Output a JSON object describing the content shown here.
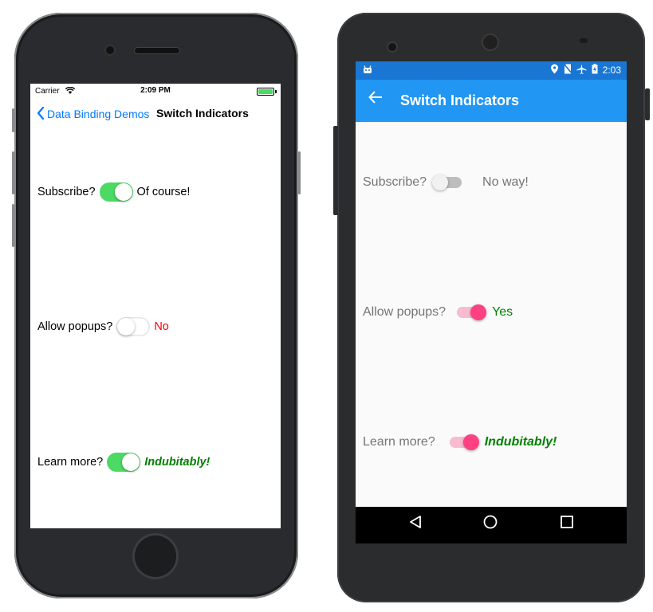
{
  "ios": {
    "status": {
      "carrier": "Carrier",
      "time": "2:09 PM"
    },
    "nav": {
      "back_label": "Data Binding Demos",
      "title": "Switch Indicators"
    },
    "rows": [
      {
        "label": "Subscribe?",
        "on": true,
        "answer": "Of course!"
      },
      {
        "label": "Allow popups?",
        "on": false,
        "answer": "No"
      },
      {
        "label": "Learn more?",
        "on": true,
        "answer": "Indubitably!"
      }
    ]
  },
  "android": {
    "status": {
      "time": "2:03"
    },
    "appbar": {
      "title": "Switch Indicators"
    },
    "rows": [
      {
        "label": "Subscribe?",
        "on": false,
        "answer": "No way!"
      },
      {
        "label": "Allow popups?",
        "on": true,
        "answer": "Yes"
      },
      {
        "label": "Learn more?",
        "on": true,
        "answer": "Indubitably!"
      }
    ]
  },
  "colors": {
    "ios_accent": "#007aff",
    "ios_switch_on": "#4cd964",
    "android_status_bar": "#1976d2",
    "android_app_bar": "#2196f3",
    "android_switch_thumb": "#ff4081",
    "answer_green": "#008000",
    "answer_red": "#ff0000"
  },
  "icons": [
    "wifi-icon",
    "battery-icon",
    "chevron-left-icon",
    "android-robot-icon",
    "location-icon",
    "no-sim-icon",
    "airplane-icon",
    "battery-charging-icon",
    "back-arrow-icon",
    "nav-back-icon",
    "nav-home-icon",
    "nav-recents-icon"
  ]
}
